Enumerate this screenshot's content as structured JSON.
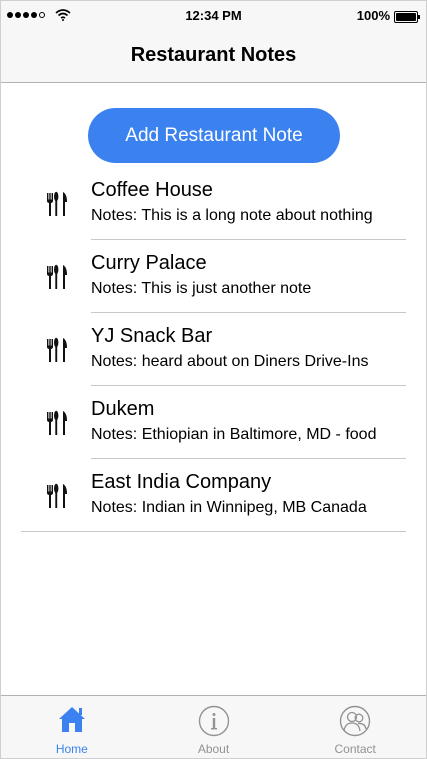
{
  "status_bar": {
    "time": "12:34 PM",
    "battery": "100%"
  },
  "nav": {
    "title": "Restaurant Notes"
  },
  "main": {
    "add_button_label": "Add Restaurant Note",
    "restaurants": [
      {
        "name": "Coffee House",
        "notes": "Notes: This is a long note about nothing"
      },
      {
        "name": "Curry Palace",
        "notes": "Notes: This is just another note"
      },
      {
        "name": "YJ Snack Bar",
        "notes": "Notes: heard about on Diners Drive-Ins"
      },
      {
        "name": "Dukem",
        "notes": "Notes: Ethiopian in Baltimore, MD - food"
      },
      {
        "name": "East India Company",
        "notes": "Notes: Indian in Winnipeg, MB Canada"
      }
    ]
  },
  "tab_bar": {
    "tabs": [
      {
        "label": "Home",
        "icon": "home-icon",
        "active": true
      },
      {
        "label": "About",
        "icon": "info-icon",
        "active": false
      },
      {
        "label": "Contact",
        "icon": "contact-icon",
        "active": false
      }
    ]
  },
  "colors": {
    "accent": "#3b82f0",
    "inactive": "#929292"
  }
}
